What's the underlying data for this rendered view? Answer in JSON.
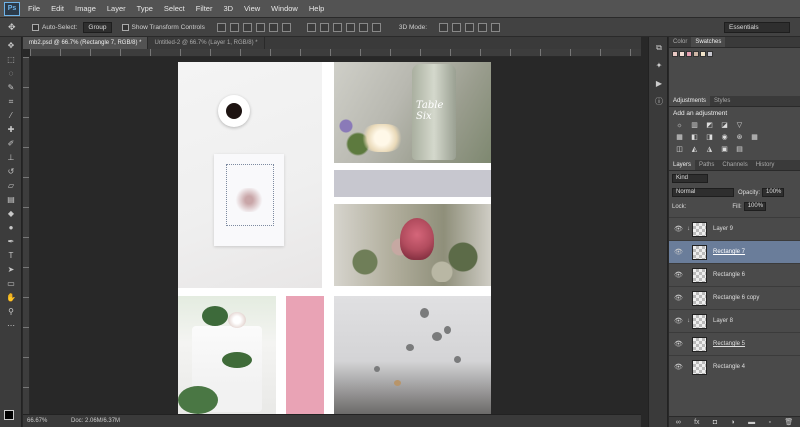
{
  "app": {
    "logo": "Ps"
  },
  "menu": [
    "File",
    "Edit",
    "Image",
    "Layer",
    "Type",
    "Select",
    "Filter",
    "3D",
    "View",
    "Window",
    "Help"
  ],
  "options": {
    "auto_select_label": "Auto-Select:",
    "auto_select_value": "Group",
    "show_transform_label": "Show Transform Controls",
    "mode_3d_label": "3D Mode:",
    "workspace_value": "Essentials"
  },
  "tabs": [
    {
      "label": "mb2.psd @ 66.7% (Rectangle 7, RGB/8) *"
    },
    {
      "label": "Untitled-2 @ 66.7% (Layer 1, RGB/8) *"
    }
  ],
  "status": {
    "zoom": "66.67%",
    "doc": "Doc: 2.06M/6.37M"
  },
  "panels": {
    "color_tab": "Color",
    "swatches_tab": "Swatches",
    "adjustments_tab": "Adjustments",
    "styles_tab": "Styles",
    "add_adjustment": "Add an adjustment",
    "layers_tab": "Layers",
    "paths_tab": "Paths",
    "channels_tab": "Channels",
    "history_tab": "History",
    "filter_kind": "Kind",
    "blend_mode": "Normal",
    "opacity_label": "Opacity:",
    "opacity_value": "100%",
    "lock_label": "Lock:",
    "fill_label": "Fill:",
    "fill_value": "100%"
  },
  "layers": [
    {
      "name": "Layer 9",
      "visible": true,
      "selected": false,
      "clipped": true,
      "underline": false
    },
    {
      "name": "Rectangle 7",
      "visible": true,
      "selected": true,
      "clipped": false,
      "underline": true
    },
    {
      "name": "Rectangle 6",
      "visible": true,
      "selected": false,
      "clipped": false,
      "underline": false
    },
    {
      "name": "Rectangle 6 copy",
      "visible": true,
      "selected": false,
      "clipped": false,
      "underline": false
    },
    {
      "name": "Layer 8",
      "visible": true,
      "selected": false,
      "clipped": true,
      "underline": false
    },
    {
      "name": "Rectangle 5",
      "visible": true,
      "selected": false,
      "clipped": false,
      "underline": true
    },
    {
      "name": "Rectangle 4",
      "visible": true,
      "selected": false,
      "clipped": false,
      "underline": false
    }
  ],
  "colors": {
    "accent_selected": "#6a7d9a",
    "pink_block": "#e9a3b5",
    "gray_band": "#c7c7cf",
    "logo_blue": "#6fb3e8"
  },
  "canvas": {
    "bottle_lettering": "Table Six"
  }
}
